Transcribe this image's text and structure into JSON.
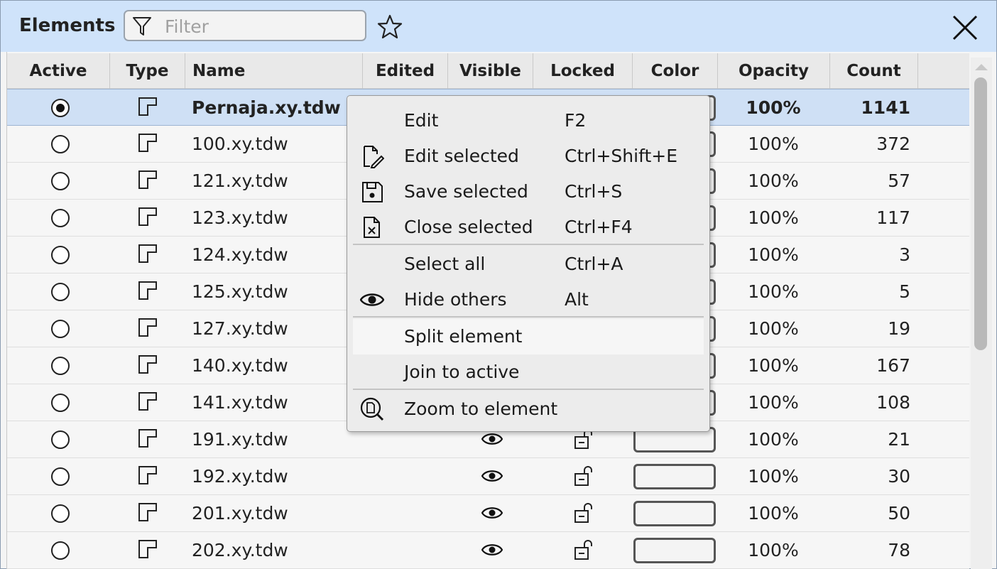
{
  "panel": {
    "title": "Elements",
    "filter_placeholder": "Filter"
  },
  "columns": [
    "Active",
    "Type",
    "Name",
    "Edited",
    "Visible",
    "Locked",
    "Color",
    "Opacity",
    "Count"
  ],
  "rows": [
    {
      "active": true,
      "name": "Pernaja.xy.tdw",
      "opacity": "100%",
      "count": "1141"
    },
    {
      "active": false,
      "name": "100.xy.tdw",
      "opacity": "100%",
      "count": "372"
    },
    {
      "active": false,
      "name": "121.xy.tdw",
      "opacity": "100%",
      "count": "57"
    },
    {
      "active": false,
      "name": "123.xy.tdw",
      "opacity": "100%",
      "count": "117"
    },
    {
      "active": false,
      "name": "124.xy.tdw",
      "opacity": "100%",
      "count": "3"
    },
    {
      "active": false,
      "name": "125.xy.tdw",
      "opacity": "100%",
      "count": "5"
    },
    {
      "active": false,
      "name": "127.xy.tdw",
      "opacity": "100%",
      "count": "19"
    },
    {
      "active": false,
      "name": "140.xy.tdw",
      "opacity": "100%",
      "count": "167"
    },
    {
      "active": false,
      "name": "141.xy.tdw",
      "opacity": "100%",
      "count": "108"
    },
    {
      "active": false,
      "name": "191.xy.tdw",
      "opacity": "100%",
      "count": "21"
    },
    {
      "active": false,
      "name": "192.xy.tdw",
      "opacity": "100%",
      "count": "30"
    },
    {
      "active": false,
      "name": "201.xy.tdw",
      "opacity": "100%",
      "count": "50"
    },
    {
      "active": false,
      "name": "202.xy.tdw",
      "opacity": "100%",
      "count": "78"
    }
  ],
  "context_menu": {
    "items": [
      {
        "label": "Edit",
        "shortcut": "F2",
        "icon": ""
      },
      {
        "label": "Edit selected",
        "shortcut": "Ctrl+Shift+E",
        "icon": "edit-document-icon"
      },
      {
        "label": "Save selected",
        "shortcut": "Ctrl+S",
        "icon": "save-icon"
      },
      {
        "label": "Close selected",
        "shortcut": "Ctrl+F4",
        "icon": "close-document-icon"
      },
      {
        "label": "Select all",
        "shortcut": "Ctrl+A",
        "icon": ""
      },
      {
        "label": "Hide others",
        "shortcut": "Alt",
        "icon": "eye-icon"
      },
      {
        "label": "Split element",
        "shortcut": "",
        "icon": "",
        "highlighted": true
      },
      {
        "label": "Join to active",
        "shortcut": "",
        "icon": ""
      },
      {
        "label": "Zoom to element",
        "shortcut": "",
        "icon": "zoom-document-icon"
      }
    ]
  },
  "colors": {
    "titlebar": "#cfe3fa",
    "selected_row": "#cfe0f5",
    "menu_background": "#ececec"
  }
}
